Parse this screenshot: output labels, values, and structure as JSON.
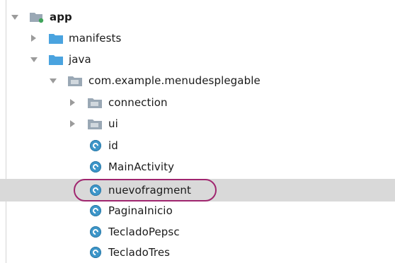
{
  "tree": {
    "nodes": [
      {
        "label": "app",
        "kind": "module",
        "expanded": true
      },
      {
        "label": "manifests",
        "kind": "folder",
        "expanded": false
      },
      {
        "label": "java",
        "kind": "folder",
        "expanded": true
      },
      {
        "label": "com.example.menudesplegable",
        "kind": "package",
        "expanded": true
      },
      {
        "label": "connection",
        "kind": "package",
        "expanded": false
      },
      {
        "label": "ui",
        "kind": "package",
        "expanded": false
      },
      {
        "label": "id",
        "kind": "class"
      },
      {
        "label": "MainActivity",
        "kind": "class"
      },
      {
        "label": "nuevofragment",
        "kind": "class",
        "selected": true,
        "highlighted": true
      },
      {
        "label": "PaginaInicio",
        "kind": "class"
      },
      {
        "label": "TecladoPepsc",
        "kind": "class"
      },
      {
        "label": "TecladoTres",
        "kind": "class"
      }
    ]
  },
  "colors": {
    "folder": "#4aa3df",
    "package_folder": "#9aa8b5",
    "class_icon": "#3d96c9",
    "selection": "#d9d9d9",
    "highlight_ring": "#a0266f",
    "module_dot": "#3fa45a"
  },
  "icons": {
    "module": "module-folder-icon",
    "folder": "folder-icon",
    "package": "package-icon",
    "class": "class-icon"
  }
}
